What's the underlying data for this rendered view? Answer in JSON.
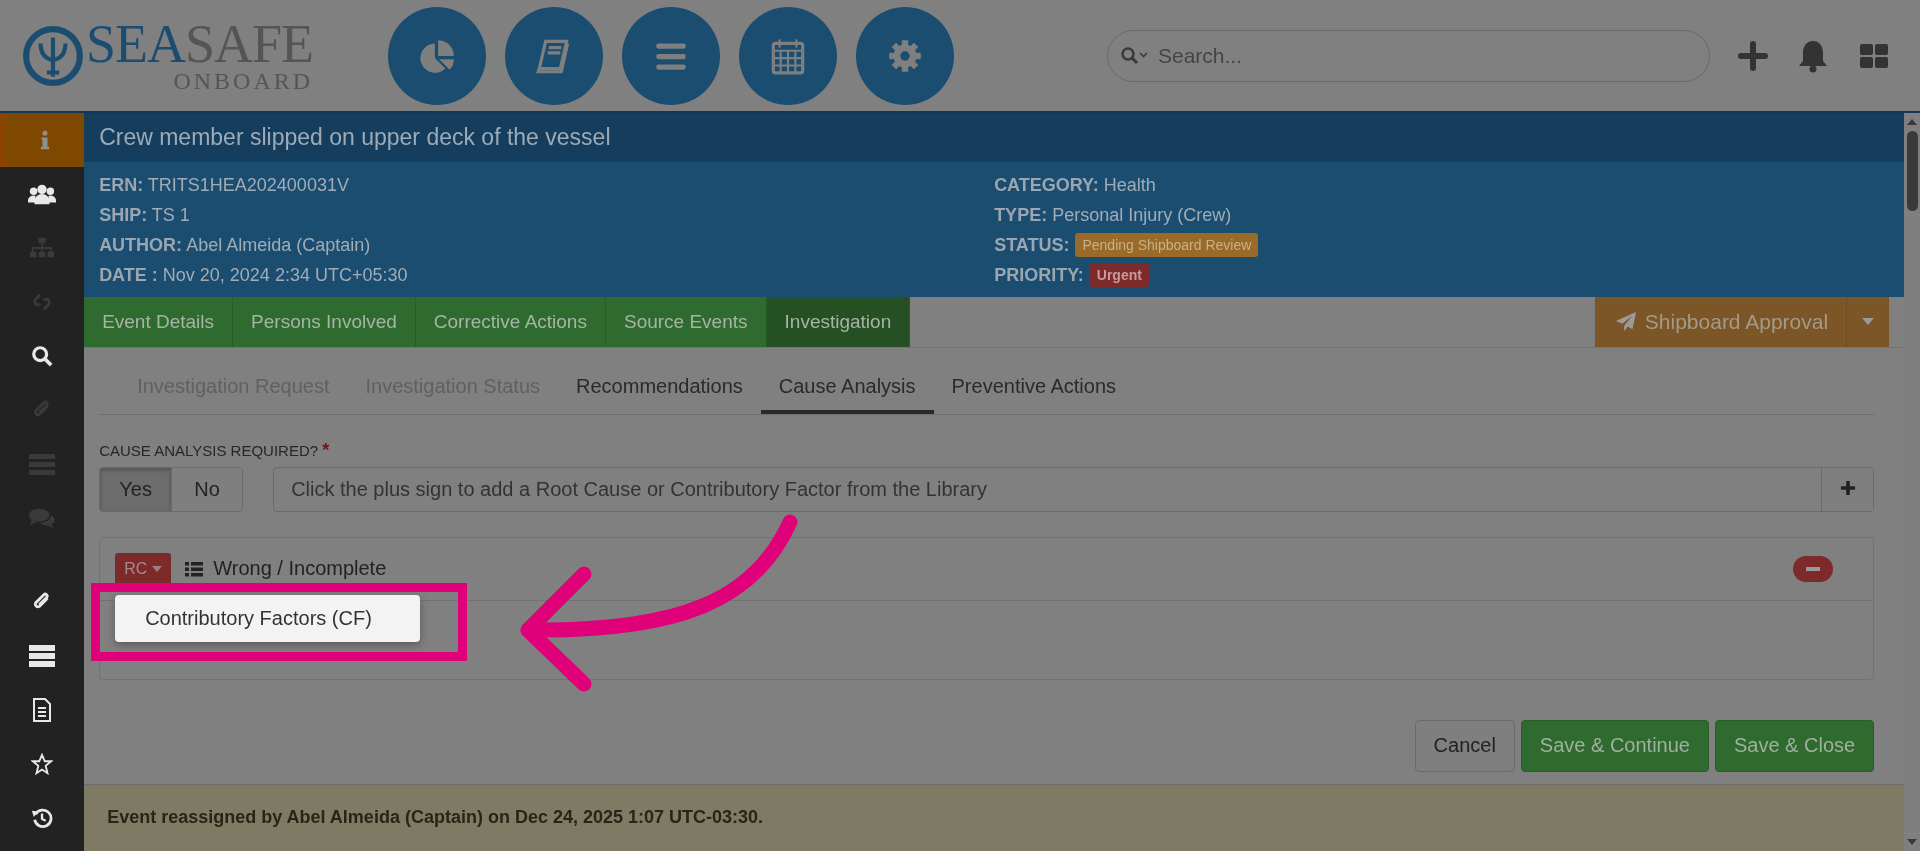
{
  "logo": {
    "word_a": "SEA",
    "word_b": "SAFE",
    "tagline": "ONBOARD"
  },
  "search": {
    "placeholder": "Search..."
  },
  "sidebar": {
    "items": [
      {
        "selected": true,
        "disabled": false
      },
      {
        "selected": false,
        "disabled": false
      },
      {
        "selected": false,
        "disabled": true
      },
      {
        "selected": false,
        "disabled": true
      },
      {
        "selected": false,
        "disabled": false
      },
      {
        "selected": false,
        "disabled": true
      },
      {
        "selected": false,
        "disabled": true
      },
      {
        "selected": false,
        "disabled": true
      },
      {
        "selected": false,
        "disabled": false
      },
      {
        "selected": false,
        "disabled": false
      },
      {
        "selected": false,
        "disabled": false
      },
      {
        "selected": false,
        "disabled": false
      },
      {
        "selected": false,
        "disabled": false
      }
    ]
  },
  "event": {
    "title": "Crew member slipped on upper deck of the vessel",
    "fields_left": [
      {
        "label": "ERN:",
        "value": "TRITS1HEA202400031V"
      },
      {
        "label": "SHIP:",
        "value": "TS 1"
      },
      {
        "label": "AUTHOR:",
        "value": "Abel Almeida (Captain)"
      },
      {
        "label": "DATE :",
        "value": "Nov 20, 2024 2:34 UTC+05:30"
      }
    ],
    "fields_right": [
      {
        "label": "CATEGORY:",
        "value": "Health",
        "kind": "text"
      },
      {
        "label": "TYPE:",
        "value": "Personal Injury (Crew)",
        "kind": "text"
      },
      {
        "label": "STATUS:",
        "value": "Pending Shipboard Review",
        "kind": "badge",
        "color": "#9a6a28"
      },
      {
        "label": "PRIORITY:",
        "value": "Urgent",
        "kind": "badge",
        "color": "#7c2a2a"
      }
    ]
  },
  "main_tabs": [
    {
      "label": "Event Details",
      "selected": false
    },
    {
      "label": "Persons Involved",
      "selected": false
    },
    {
      "label": "Corrective Actions",
      "selected": false
    },
    {
      "label": "Source Events",
      "selected": false
    },
    {
      "label": "Investigation",
      "selected": true
    }
  ],
  "approval_button": {
    "label": "Shipboard Approval"
  },
  "sub_tabs": [
    {
      "label": "Investigation Request",
      "selected": false,
      "disabled": true
    },
    {
      "label": "Investigation Status",
      "selected": false,
      "disabled": true
    },
    {
      "label": "Recommendations",
      "selected": false,
      "disabled": false
    },
    {
      "label": "Cause Analysis",
      "selected": true,
      "disabled": false
    },
    {
      "label": "Preventive Actions",
      "selected": false,
      "disabled": false
    }
  ],
  "cause_analysis": {
    "label": "CAUSE ANALYSIS REQUIRED?",
    "required_mark": "*",
    "options": [
      {
        "label": "Yes",
        "selected": true
      },
      {
        "label": "No",
        "selected": false
      }
    ],
    "library_field": {
      "placeholder": "Click the plus sign to add a Root Cause or Contributory Factor from the Library"
    },
    "items": [
      {
        "badge": "RC",
        "title": "Wrong / Incomplete",
        "menu": [
          {
            "label": "Contributory Factors (CF)"
          }
        ]
      }
    ]
  },
  "buttons": [
    {
      "label": "Cancel",
      "kind": "default"
    },
    {
      "label": "Save & Continue",
      "kind": "primary"
    },
    {
      "label": "Save & Close",
      "kind": "primary"
    }
  ],
  "footer_note": "Event reassigned by Abel Almeida (Captain) on Dec 24, 2025 1:07 UTC-03:30."
}
